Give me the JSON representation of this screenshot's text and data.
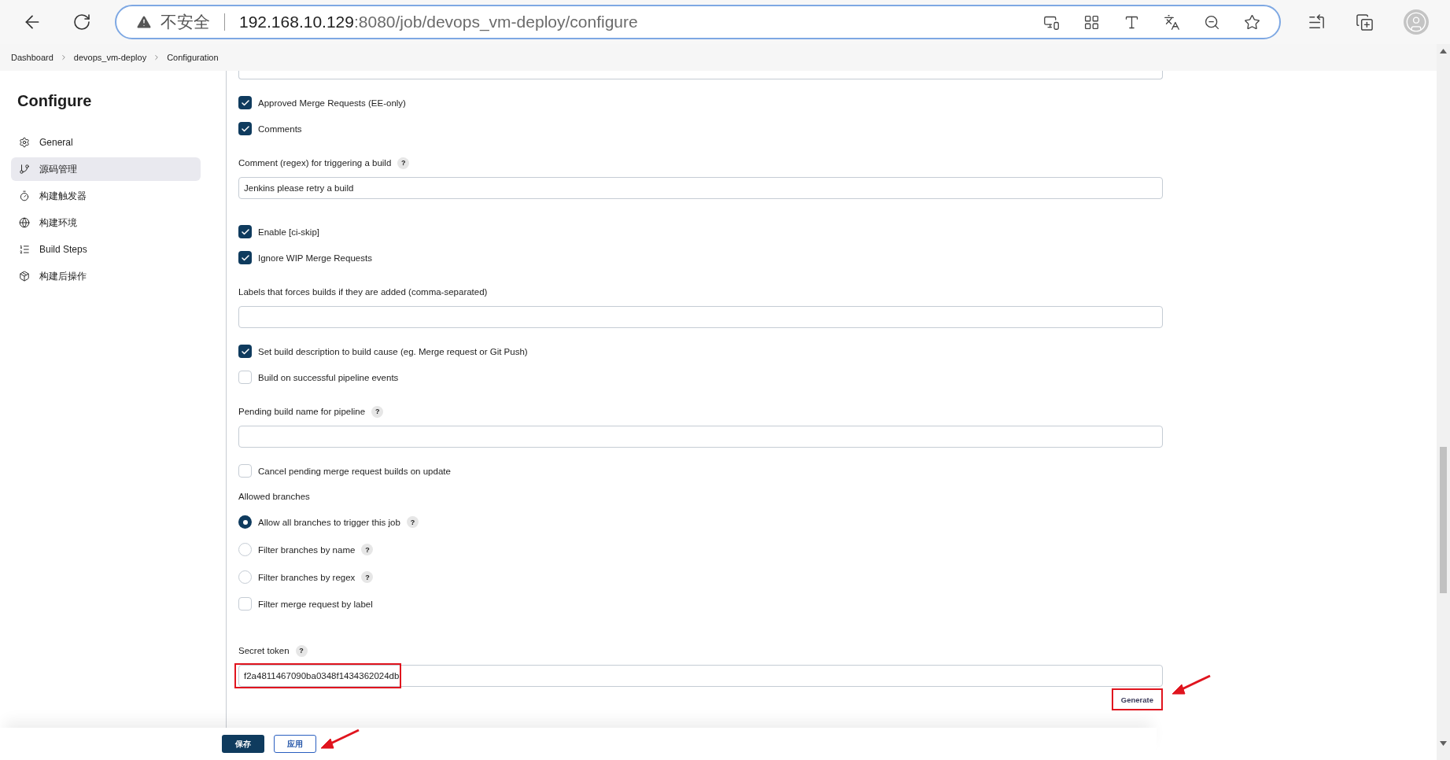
{
  "browser": {
    "security_label": "不安全",
    "url_host": "192.168.10.129",
    "url_path": ":8080/job/devops_vm-deploy/configure"
  },
  "breadcrumb": [
    {
      "label": "Dashboard"
    },
    {
      "label": "devops_vm-deploy"
    },
    {
      "label": "Configuration"
    }
  ],
  "sidebar": {
    "title": "Configure",
    "items": [
      {
        "label": "General",
        "selected": false
      },
      {
        "label": "源码管理",
        "selected": true
      },
      {
        "label": "构建触发器",
        "selected": false
      },
      {
        "label": "构建环境",
        "selected": false
      },
      {
        "label": "Build Steps",
        "selected": false
      },
      {
        "label": "构建后操作",
        "selected": false
      }
    ]
  },
  "form": {
    "items": [
      {
        "kind": "checkbox",
        "label": "Approved Merge Requests (EE-only)",
        "checked": true
      },
      {
        "kind": "checkbox",
        "label": "Comments",
        "checked": true
      },
      {
        "kind": "field",
        "label": "Comment (regex) for triggering a build",
        "help": "?",
        "value": "Jenkins please retry a build"
      },
      {
        "kind": "checkbox",
        "label": "Enable [ci-skip]",
        "checked": true
      },
      {
        "kind": "checkbox",
        "label": "Ignore WIP Merge Requests",
        "checked": true
      },
      {
        "kind": "field",
        "label": "Labels that forces builds if they are added (comma-separated)"
      },
      {
        "kind": "checkbox",
        "label": "Set build description to build cause (eg. Merge request or Git Push)",
        "checked": true
      },
      {
        "kind": "checkbox",
        "label": "Build on successful pipeline events",
        "checked": false
      },
      {
        "kind": "field",
        "label": "Pending build name for pipeline",
        "help": "?"
      },
      {
        "kind": "checkbox",
        "label": "Cancel pending merge request builds on update",
        "checked": false
      },
      {
        "kind": "heading",
        "label": "Allowed branches"
      },
      {
        "kind": "radio",
        "label": "Allow all branches to trigger this job",
        "help": "?",
        "selected": true
      },
      {
        "kind": "radio",
        "label": "Filter branches by name",
        "help": "?",
        "selected": false
      },
      {
        "kind": "radio",
        "label": "Filter branches by regex",
        "help": "?",
        "selected": false
      },
      {
        "kind": "checkbox",
        "label": "Filter merge request by label",
        "checked": false
      },
      {
        "kind": "token",
        "label": "Secret token",
        "help": "?",
        "value": "f2a4811467090ba0348f1434362024db",
        "highlighted": true,
        "button": {
          "label": "Generate",
          "highlighted": true
        }
      }
    ]
  },
  "footer": {
    "buttons": [
      {
        "label": "保存",
        "kind": "primary",
        "arrow": false
      },
      {
        "label": "应用",
        "kind": "secondary",
        "arrow": true
      }
    ]
  }
}
